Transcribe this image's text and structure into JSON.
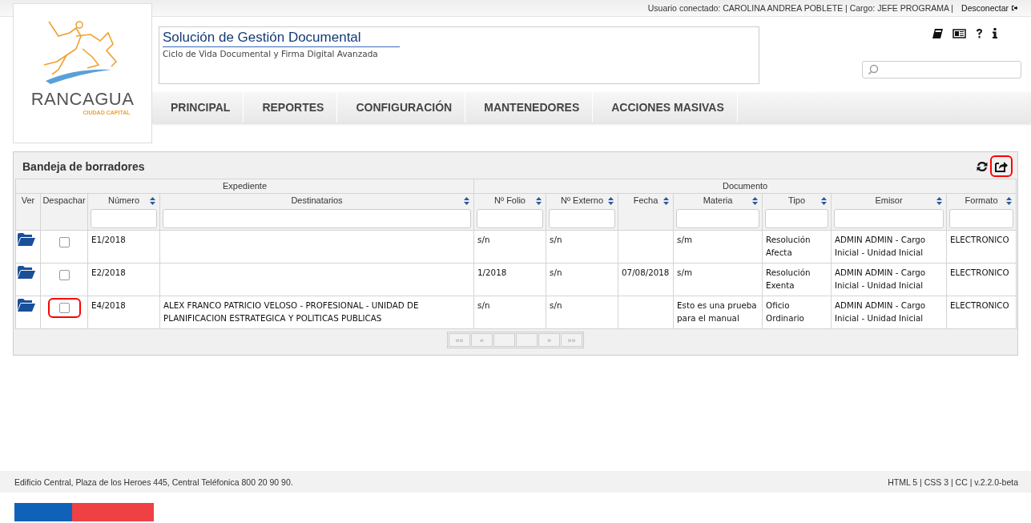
{
  "top_bar": {
    "user_info": "Usuario conectado: CAROLINA ANDREA POBLETE | Cargo: JEFE PROGRAMA |",
    "logout": "Desconectar"
  },
  "logo": {
    "name": "RANCAGUA",
    "tagline": "CIUDAD CAPITAL"
  },
  "app_header": {
    "title": "Solución de Gestión Documental",
    "subtitle": "Ciclo de Vida Documental y Firma Digital Avanzada"
  },
  "nav": [
    {
      "label": "PRINCIPAL",
      "selected": false
    },
    {
      "label": "REPORTES",
      "selected": false
    },
    {
      "label": "CONFIGURACIÓN",
      "selected": false
    },
    {
      "label": "MANTENEDORES",
      "selected": false
    },
    {
      "label": "ACCIONES MASIVAS",
      "selected": false
    }
  ],
  "panel": {
    "title": "Bandeja de borradores",
    "export_highlighted": true,
    "groups": [
      {
        "label": "Expediente",
        "columns": [
          {
            "label": "Ver",
            "kind": "icon",
            "sortable": false,
            "filter": false
          },
          {
            "label": "Despachar",
            "kind": "check",
            "sortable": false,
            "filter": false
          },
          {
            "label": "Número",
            "kind": "text",
            "sortable": true,
            "filter": true
          },
          {
            "label": "Destinatarios",
            "kind": "text",
            "sortable": true,
            "filter": true
          }
        ]
      },
      {
        "label": "Documento",
        "columns": [
          {
            "label": "Nº Folio",
            "kind": "text",
            "sortable": true,
            "filter": true
          },
          {
            "label": "Nº Externo",
            "kind": "text",
            "sortable": true,
            "filter": true
          },
          {
            "label": "Fecha",
            "kind": "text",
            "sortable": true,
            "filter": false
          },
          {
            "label": "Materia",
            "kind": "text",
            "sortable": true,
            "filter": true
          },
          {
            "label": "Tipo",
            "kind": "text",
            "sortable": true,
            "filter": true
          },
          {
            "label": "Emisor",
            "kind": "text",
            "sortable": true,
            "filter": true
          },
          {
            "label": "Formato",
            "kind": "text",
            "sortable": true,
            "filter": true
          }
        ]
      }
    ],
    "rows": [
      {
        "checked": false,
        "highlighted": false,
        "cells": [
          "",
          "",
          "E1/2018",
          "",
          "s/n",
          "s/n",
          "",
          "s/m",
          "Resolución Afecta",
          "ADMIN ADMIN - Cargo Inicial - Unidad Inicial",
          "ELECTRONICO"
        ]
      },
      {
        "checked": false,
        "highlighted": false,
        "cells": [
          "",
          "",
          "E2/2018",
          "",
          "1/2018",
          "s/n",
          "07/08/2018",
          "s/m",
          "Resolución Exenta",
          "ADMIN ADMIN - Cargo Inicial - Unidad Inicial",
          "ELECTRONICO"
        ]
      },
      {
        "checked": false,
        "highlighted": true,
        "cells": [
          "",
          "",
          "E4/2018",
          "ALEX FRANCO PATRICIO VELOSO - PROFESIONAL - UNIDAD DE PLANIFICACION ESTRATEGICA Y POLITICAS PUBLICAS",
          "s/n",
          "s/n",
          "",
          "Esto es una prueba para el manual",
          "Oficio Ordinario",
          "ADMIN ADMIN - Cargo Inicial - Unidad Inicial",
          "ELECTRONICO"
        ]
      }
    ],
    "pager": {
      "back": [
        "««",
        "«"
      ],
      "forward": [
        "»",
        "»»"
      ]
    }
  },
  "footer": {
    "address": "Edificio Central, Plaza de los Heroes 445, Central Teléfonica 800 20 90 90.",
    "version": "HTML 5 | CSS 3 | CC | v.2.2.0-beta"
  }
}
